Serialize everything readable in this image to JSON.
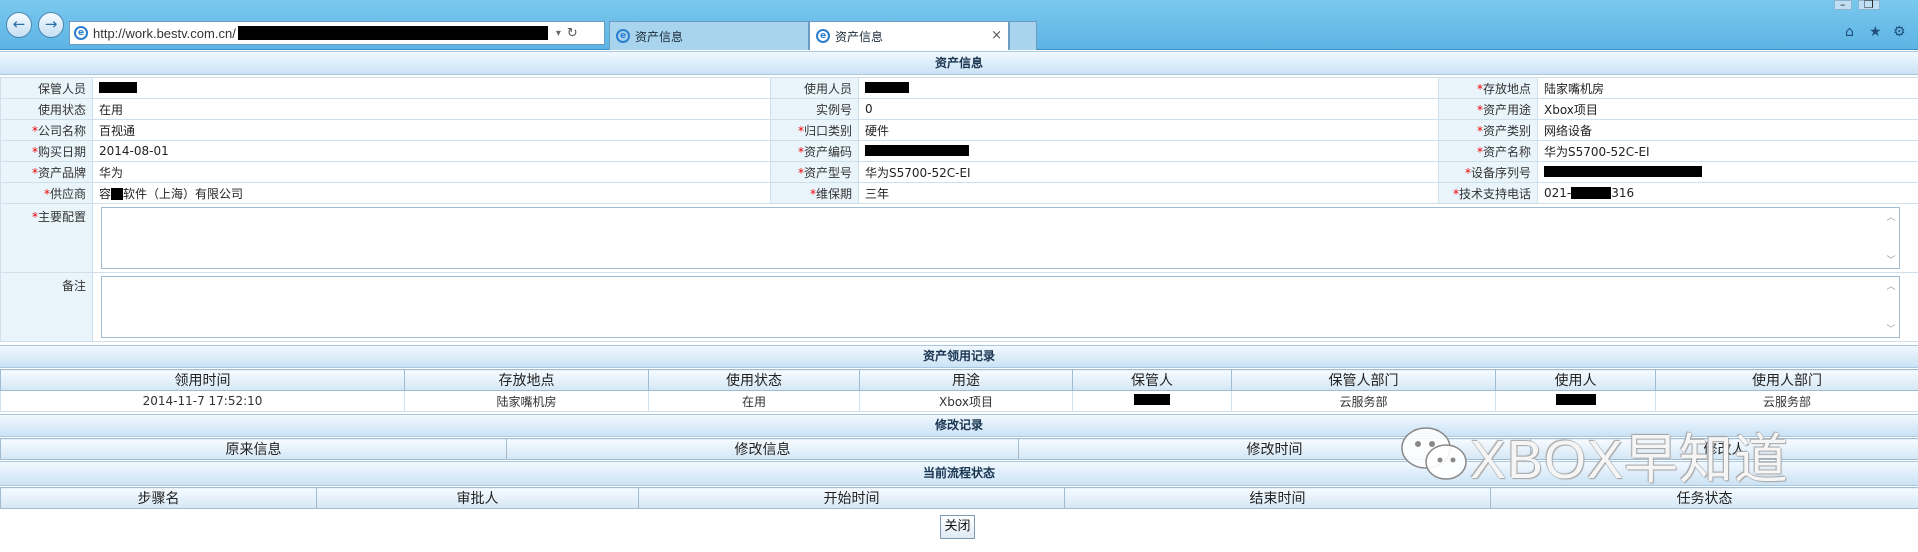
{
  "browser": {
    "address": "http://work.bestv.com.cn/",
    "tabs": [
      {
        "label": "资产信息"
      },
      {
        "label": "资产信息"
      }
    ],
    "tab_close": "×",
    "back": "←",
    "forward": "→",
    "icons": [
      "back-icon",
      "forward-icon",
      "ie-logo-icon",
      "refresh-icon",
      "home-icon",
      "star-icon",
      "gear-icon"
    ]
  },
  "asset_info": {
    "title": "资产信息",
    "rows": [
      [
        {
          "label": "保管人员",
          "required": false,
          "value": ""
        },
        {
          "label": "使用人员",
          "required": false,
          "value": ""
        },
        {
          "label": "存放地点",
          "required": true,
          "value": "陆家嘴机房"
        }
      ],
      [
        {
          "label": "使用状态",
          "required": false,
          "value": "在用"
        },
        {
          "label": "实例号",
          "required": false,
          "value": "0"
        },
        {
          "label": "资产用途",
          "required": true,
          "value": "Xbox项目"
        }
      ],
      [
        {
          "label": "公司名称",
          "required": true,
          "value": "百视通"
        },
        {
          "label": "归口类别",
          "required": true,
          "value": "硬件"
        },
        {
          "label": "资产类别",
          "required": true,
          "value": "网络设备"
        }
      ],
      [
        {
          "label": "购买日期",
          "required": true,
          "value": "2014-08-01"
        },
        {
          "label": "资产编码",
          "required": true,
          "value": ""
        },
        {
          "label": "资产名称",
          "required": true,
          "value": "华为S5700-52C-EI"
        }
      ],
      [
        {
          "label": "资产品牌",
          "required": true,
          "value": "华为"
        },
        {
          "label": "资产型号",
          "required": true,
          "value": "华为S5700-52C-EI"
        },
        {
          "label": "设备序列号",
          "required": true,
          "value": ""
        }
      ],
      [
        {
          "label": "供应商",
          "required": true,
          "value_prefix": "容",
          "value": "软件（上海）有限公司"
        },
        {
          "label": "维保期",
          "required": true,
          "value": "三年"
        },
        {
          "label": "技术支持电话",
          "required": true,
          "value_prefix": "021-",
          "value": "316"
        }
      ]
    ],
    "main_config_label": "主要配置",
    "remarks_label": "备注"
  },
  "usage_records": {
    "title": "资产领用记录",
    "columns": [
      "领用时间",
      "存放地点",
      "使用状态",
      "用途",
      "保管人",
      "保管人部门",
      "使用人",
      "使用人部门"
    ],
    "rows": [
      [
        "2014-11-7 17:52:10",
        "陆家嘴机房",
        "在用",
        "Xbox项目",
        "",
        "云服务部",
        "",
        "云服务部"
      ]
    ]
  },
  "modify_records": {
    "title": "修改记录",
    "columns": [
      "原来信息",
      "修改信息",
      "修改时间",
      "修改人"
    ]
  },
  "flow_status": {
    "title": "当前流程状态",
    "columns": [
      "步骤名",
      "审批人",
      "开始时间",
      "结束时间",
      "任务状态"
    ]
  },
  "close_button": "关闭",
  "watermark": "XBOX早知道",
  "colors": {
    "header_bg": "#cbe3f5",
    "label_bg": "#e9f4fb",
    "required": "#e00000",
    "chrome": "#6bbde8"
  }
}
